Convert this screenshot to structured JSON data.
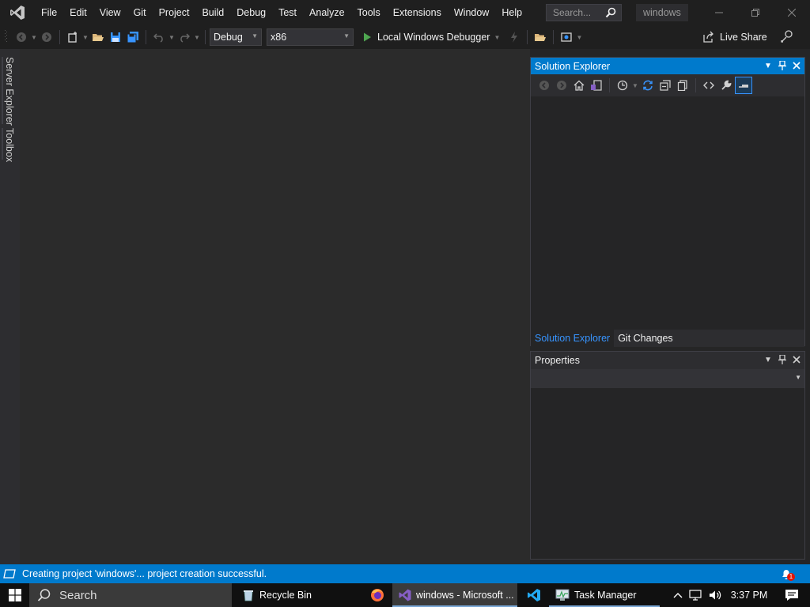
{
  "menu": [
    "File",
    "Edit",
    "View",
    "Git",
    "Project",
    "Build",
    "Debug",
    "Test",
    "Analyze",
    "Tools",
    "Extensions",
    "Window",
    "Help"
  ],
  "search": {
    "placeholder": "Search..."
  },
  "solution_name": "windows",
  "toolbar": {
    "configuration": "Debug",
    "platform": "x86",
    "debugger_label": "Local Windows Debugger",
    "liveshare_label": "Live Share"
  },
  "left_tabs": {
    "server_explorer": "Server Explorer",
    "toolbox": "Toolbox"
  },
  "solution_explorer": {
    "title": "Solution Explorer",
    "tabs": [
      "Solution Explorer",
      "Git Changes"
    ]
  },
  "properties": {
    "title": "Properties"
  },
  "status": {
    "message": "Creating project 'windows'... project creation successful.",
    "notification_count": "1"
  },
  "taskbar": {
    "search_label": "Search",
    "tasks": [
      "Recycle Bin",
      "windows - Microsoft ...",
      "Task Manager"
    ],
    "time": "3:37 PM"
  },
  "colors": {
    "accent": "#007acc",
    "vs_purple": "#865fc5",
    "play_green": "#4ea650",
    "folder_yellow": "#dcb67a"
  }
}
